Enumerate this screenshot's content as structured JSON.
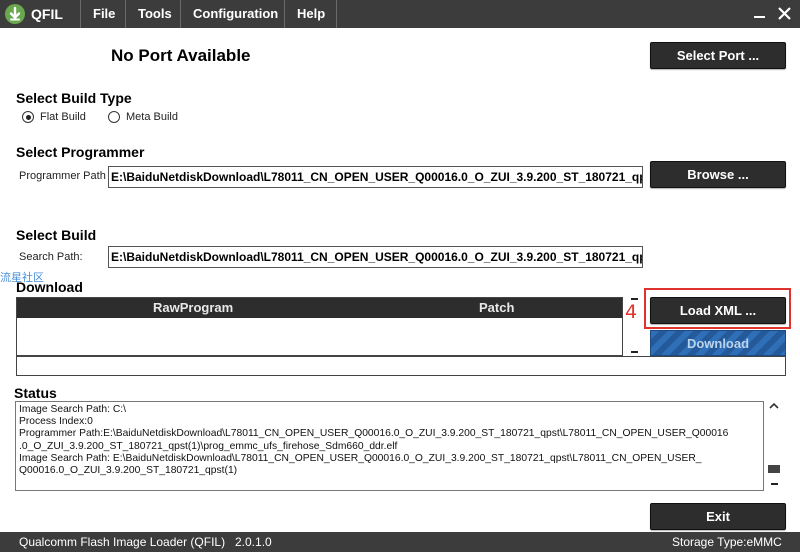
{
  "app": {
    "name": "QFIL"
  },
  "menu": {
    "file": "File",
    "tools": "Tools",
    "configuration": "Configuration",
    "help": "Help"
  },
  "port": {
    "status": "No Port Available",
    "select_button": "Select Port ..."
  },
  "build_type": {
    "title": "Select Build Type",
    "flat": "Flat Build",
    "meta": "Meta Build",
    "selected": "Flat Build"
  },
  "programmer": {
    "title": "Select Programmer",
    "label": "Programmer Path",
    "value": "E:\\BaiduNetdiskDownload\\L78011_CN_OPEN_USER_Q00016.0_O_ZUI_3.9.200_ST_180721_qpst\\L78011_CN_OPEN_USER_Q00016.0_O_ZUI_3.9.200_ST_180721_qpst(1)\\prog_emmc_ufs_firehose_Sdm660_ddr.elf",
    "browse_button": "Browse ..."
  },
  "build": {
    "title": "Select Build",
    "label": "Search Path:",
    "value": "E:\\BaiduNetdiskDownload\\L78011_CN_OPEN_USER_Q00016.0_O_ZUI_3.9.200_ST_180721_qpst\\L78011_CN_OPEN_USER_Q00016.0_O_ZUI_3.9.200_ST_180721_qpst(1)"
  },
  "watermark": "流星社区",
  "download": {
    "title": "Download",
    "col_rawprogram": "RawProgram",
    "col_patch": "Patch",
    "load_xml_button": "Load XML ...",
    "download_button": "Download",
    "annotation_number": "4"
  },
  "status": {
    "title": "Status",
    "lines": [
      "Image Search Path: C:\\",
      "Process Index:0",
      "Programmer Path:E:\\BaiduNetdiskDownload\\L78011_CN_OPEN_USER_Q00016.0_O_ZUI_3.9.200_ST_180721_qpst\\L78011_CN_OPEN_USER_Q00016",
      ".0_O_ZUI_3.9.200_ST_180721_qpst(1)\\prog_emmc_ufs_firehose_Sdm660_ddr.elf",
      "Image Search Path: E:\\BaiduNetdiskDownload\\L78011_CN_OPEN_USER_Q00016.0_O_ZUI_3.9.200_ST_180721_qpst\\L78011_CN_OPEN_USER_",
      "Q00016.0_O_ZUI_3.9.200_ST_180721_qpst(1)"
    ]
  },
  "exit_button": "Exit",
  "footer": {
    "app_full_name": "Qualcomm Flash Image Loader (QFIL)",
    "version": "2.0.1.0",
    "storage": "Storage Type:eMMC"
  },
  "colors": {
    "bar": "#3c3c3c",
    "button": "#2d2d2d",
    "highlight": "#e0322d",
    "download": "#2f6fb8"
  }
}
